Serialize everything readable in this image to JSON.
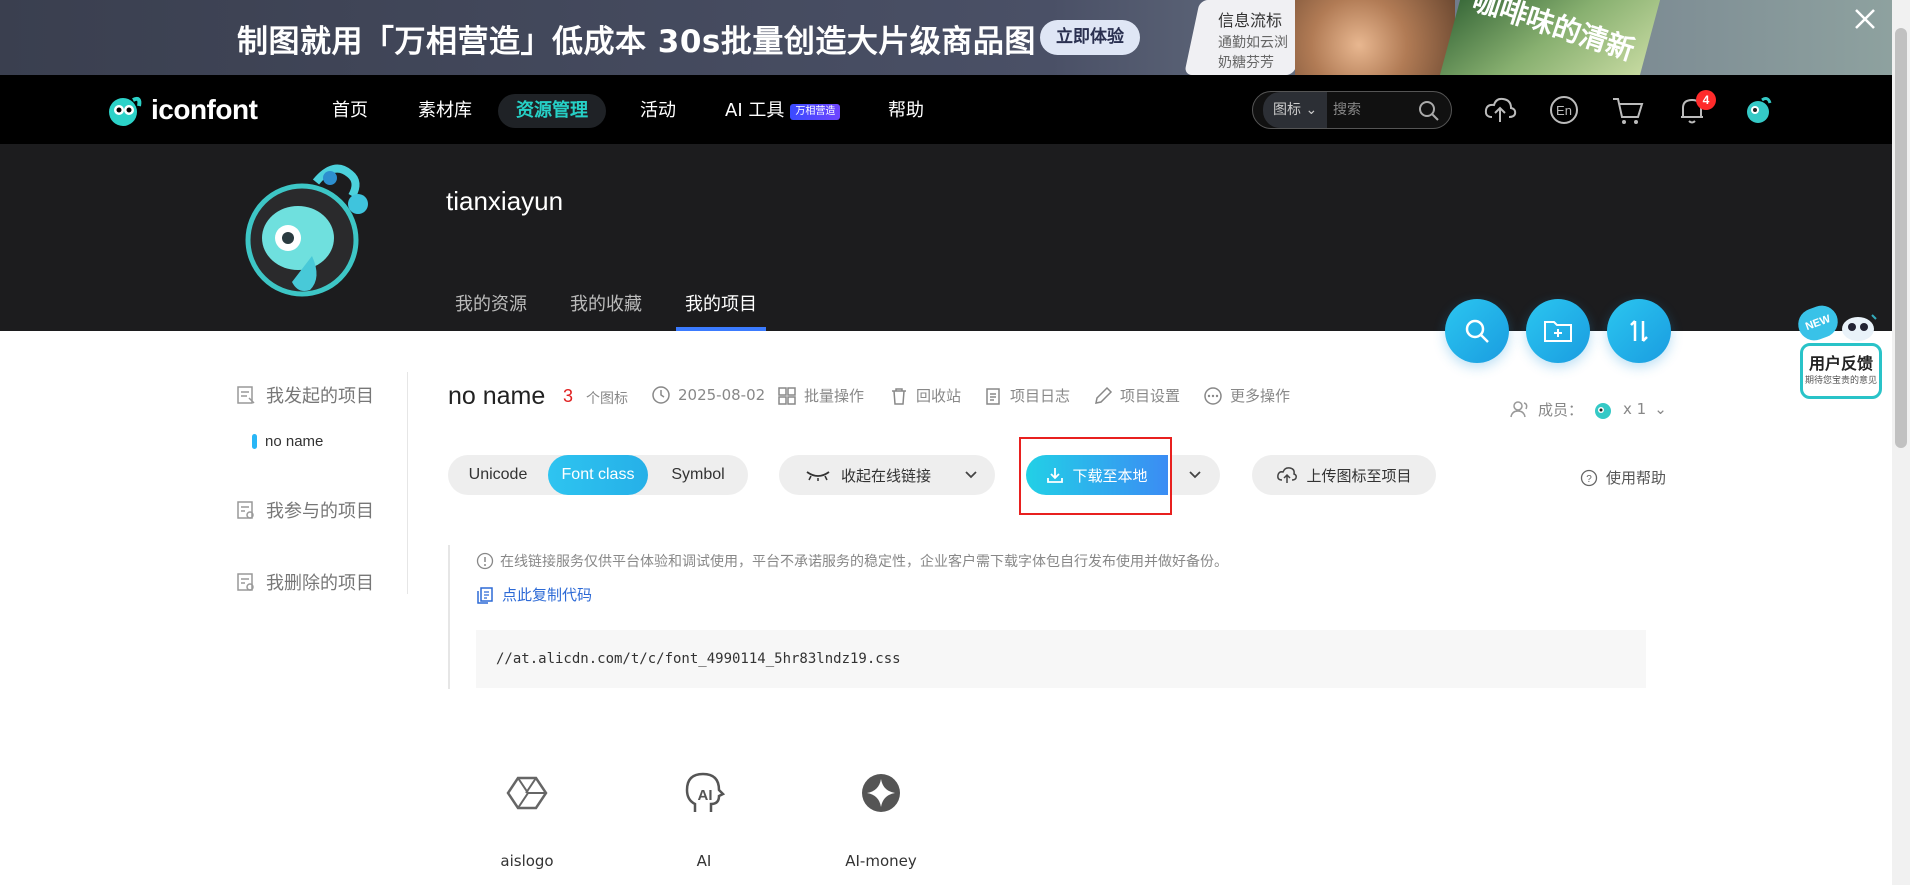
{
  "banner": {
    "headline": "制图就用「万相营造」低成本 30s批量创造大片级商品图",
    "cta": "立即体验",
    "card_title": "信息流标",
    "card_line1": "通勤如云浏",
    "card_line2": "奶糖芬芳",
    "slogan": "咖啡味的清新"
  },
  "nav": {
    "logo": "iconfont",
    "items": [
      "首页",
      "素材库",
      "资源管理",
      "活动",
      "AI 工具",
      "帮助"
    ],
    "ai_badge": "万相营造",
    "search_type": "图标",
    "search_placeholder": "搜索",
    "notification_count": "4"
  },
  "profile": {
    "username": "tianxiayun",
    "tabs": [
      "我的资源",
      "我的收藏",
      "我的项目"
    ]
  },
  "feedback": {
    "new": "NEW",
    "title": "用户反馈",
    "subtitle": "期待您宝贵的意见"
  },
  "sidebar": {
    "started": "我发起的项目",
    "started_item": "no name",
    "joined": "我参与的项目",
    "deleted": "我删除的项目"
  },
  "project": {
    "name": "no name",
    "count": "3",
    "count_unit": "个图标",
    "date": "2025-08-02",
    "actions": [
      "批量操作",
      "回收站",
      "项目日志",
      "项目设置",
      "更多操作"
    ],
    "members_label": "成员：",
    "members_count": "x 1"
  },
  "toolbar": {
    "segments": [
      "Unicode",
      "Font class",
      "Symbol"
    ],
    "collapse": "收起在线链接",
    "download": "下载至本地",
    "upload": "上传图标至项目",
    "help": "使用帮助"
  },
  "notice": {
    "text": "在线链接服务仅供平台体验和调试使用，平台不承诺服务的稳定性，企业客户需下载字体包自行发布使用并做好备份。",
    "copy": "点此复制代码",
    "css_url": "//at.alicdn.com/t/c/font_4990114_5hr83lndz19.css"
  },
  "icons": [
    {
      "name": "aislogo"
    },
    {
      "name": "AI"
    },
    {
      "name": "AI-money"
    }
  ],
  "colors": {
    "accent": "#26b0e8",
    "nav_active": "#26d0c6",
    "highlight": "#e8201f",
    "count_red": "#e02020"
  }
}
